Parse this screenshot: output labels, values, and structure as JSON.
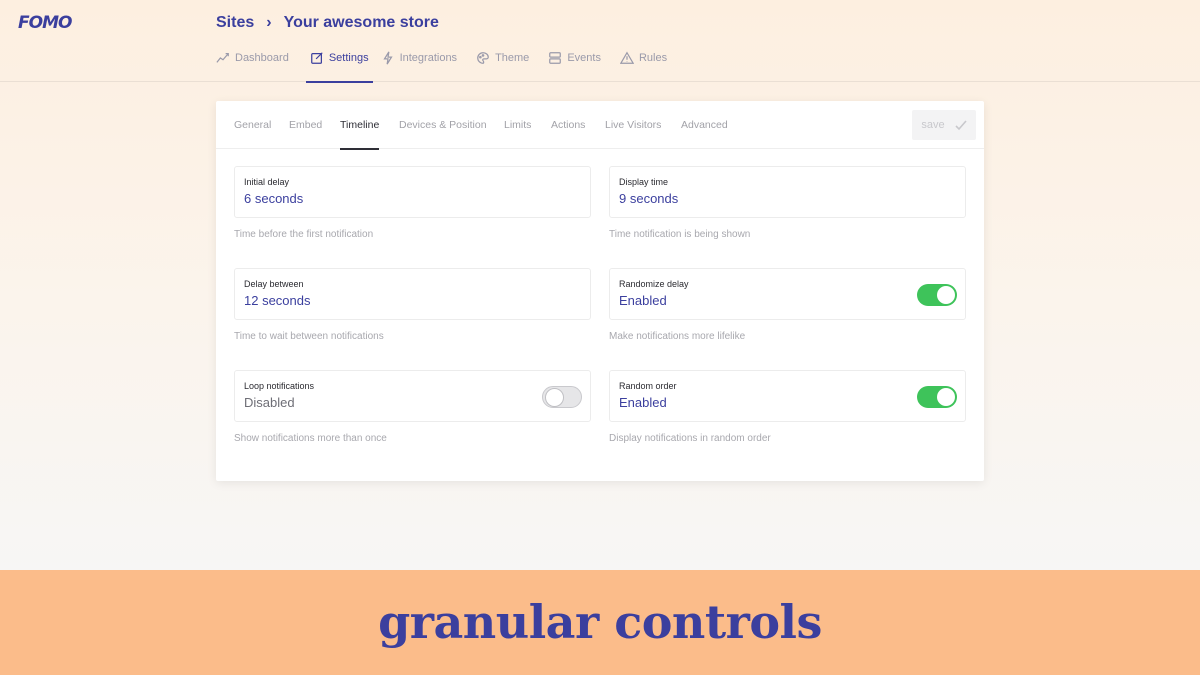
{
  "app": {
    "logo": "FOMO"
  },
  "breadcrumb": {
    "root": "Sites",
    "separator": "›",
    "current": "Your awesome store"
  },
  "main_nav": [
    {
      "label": "Dashboard",
      "icon": "chart-line-icon",
      "active": false
    },
    {
      "label": "Settings",
      "icon": "edit-icon",
      "active": true
    },
    {
      "label": "Integrations",
      "icon": "bolt-icon",
      "active": false
    },
    {
      "label": "Theme",
      "icon": "palette-icon",
      "active": false
    },
    {
      "label": "Events",
      "icon": "list-icon",
      "active": false
    },
    {
      "label": "Rules",
      "icon": "warning-icon",
      "active": false
    }
  ],
  "tabs": [
    {
      "label": "General"
    },
    {
      "label": "Embed"
    },
    {
      "label": "Timeline",
      "active": true
    },
    {
      "label": "Devices & Position"
    },
    {
      "label": "Limits"
    },
    {
      "label": "Actions"
    },
    {
      "label": "Live Visitors"
    },
    {
      "label": "Advanced"
    }
  ],
  "save": {
    "label": "save",
    "icon": "check-icon"
  },
  "settings": {
    "initial_delay": {
      "label": "Initial delay",
      "value": "6 seconds",
      "help": "Time before the first notification"
    },
    "display_time": {
      "label": "Display time",
      "value": "9 seconds",
      "help": "Time notification is being shown"
    },
    "delay_between": {
      "label": "Delay between",
      "value": "12 seconds",
      "help": "Time to wait between notifications"
    },
    "randomize_delay": {
      "label": "Randomize delay",
      "value": "Enabled",
      "help": "Make notifications more lifelike",
      "on": true
    },
    "loop_notifications": {
      "label": "Loop notifications",
      "value": "Disabled",
      "help": "Show notifications more than once",
      "on": false
    },
    "random_order": {
      "label": "Random order",
      "value": "Enabled",
      "help": "Display notifications in random order",
      "on": true
    }
  },
  "banner": {
    "text": "granular controls"
  },
  "colors": {
    "brand": "#3b3f9e",
    "toggle_on": "#3ec35a",
    "banner_bg": "#fbbc8a"
  }
}
